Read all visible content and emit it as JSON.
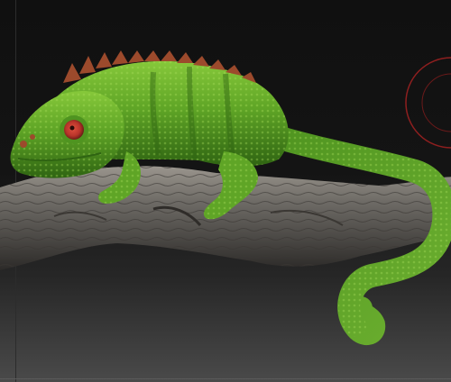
{
  "scene": {
    "subject": "chameleon-on-branch",
    "colors": {
      "background_top": "#101010",
      "background_bottom": "#4a4a4a",
      "skin_green": "#5fa526",
      "skin_highlight": "#86c83a",
      "skin_shadow": "#2f6412",
      "crest_red": "#9c4a2c",
      "eye_red": "#b8342a",
      "branch_gray": "#6d6a65",
      "gizmo_red": "#8e1f1f"
    }
  }
}
